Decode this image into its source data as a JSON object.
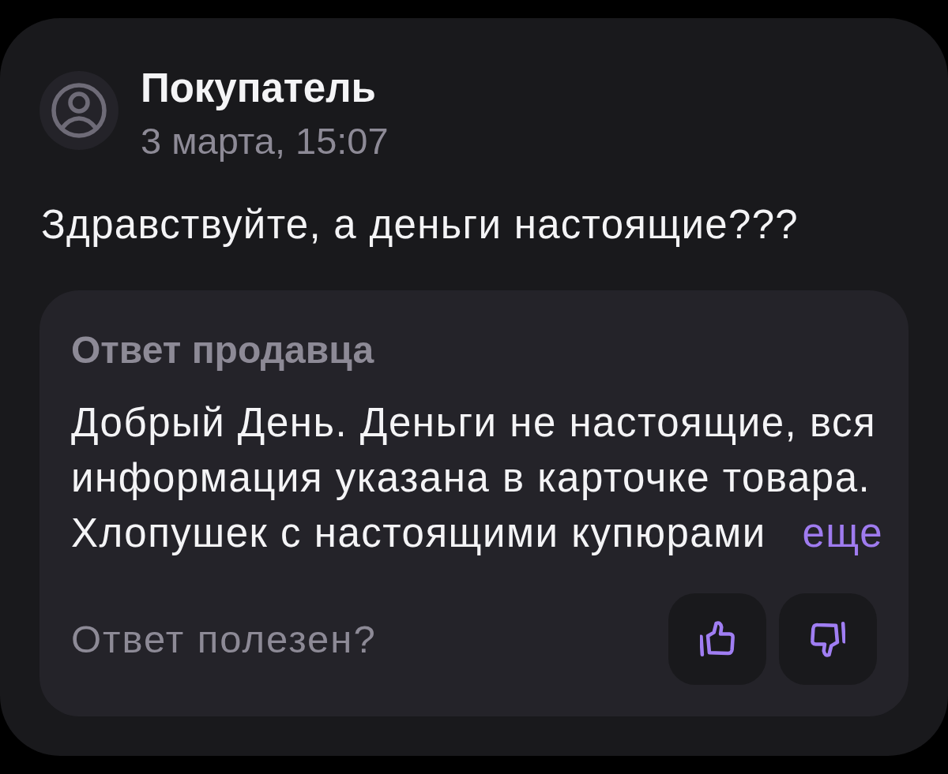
{
  "review": {
    "author": "Покупатель",
    "date": "3 марта, 15:07",
    "question": "Здравствуйте, а деньги настоящие???"
  },
  "seller_reply": {
    "title": "Ответ продавца",
    "text": "Добрый День. Деньги не настоящие, вся информация указана в карточке товара. Хлопушек с настоящими купюрами",
    "more_link": "еще"
  },
  "feedback": {
    "prompt": "Ответ полезен?",
    "buttons": [
      {
        "kind": "like"
      },
      {
        "kind": "dislike"
      }
    ]
  }
}
